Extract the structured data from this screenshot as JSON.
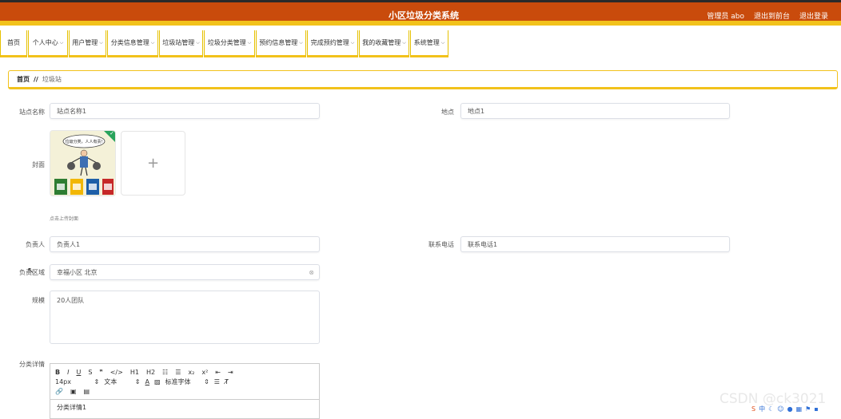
{
  "header": {
    "title": "小区垃圾分类系统",
    "admin_label": "管理员 abo",
    "back_label": "退出到前台",
    "logout_label": "退出登录"
  },
  "nav": {
    "items": [
      {
        "label": "首页",
        "dropdown": false
      },
      {
        "label": "个人中心",
        "dropdown": true
      },
      {
        "label": "用户管理",
        "dropdown": true
      },
      {
        "label": "分类信息管理",
        "dropdown": true
      },
      {
        "label": "垃圾站管理",
        "dropdown": true
      },
      {
        "label": "垃圾分类管理",
        "dropdown": true
      },
      {
        "label": "预约信息管理",
        "dropdown": true
      },
      {
        "label": "完成预约管理",
        "dropdown": true
      },
      {
        "label": "我的收藏管理",
        "dropdown": true
      },
      {
        "label": "系统管理",
        "dropdown": true
      }
    ]
  },
  "breadcrumb": {
    "home": "首页",
    "separator": "//",
    "current": "垃圾站"
  },
  "form": {
    "station_name": {
      "label": "站点名称",
      "value": "站点名称1"
    },
    "location": {
      "label": "地点",
      "value": "地点1"
    },
    "cover": {
      "label": "封面",
      "hint": "点击上传封面",
      "caption": "垃圾分类，人人有责!"
    },
    "manager": {
      "label": "负责人",
      "value": "负责人1"
    },
    "phone": {
      "label": "联系电话",
      "value": "联系电话1"
    },
    "area": {
      "label": "负责区域",
      "value": "幸福小区 北京"
    },
    "scale": {
      "label": "规模",
      "value": "20人团队"
    },
    "detail": {
      "label": "分类详情"
    }
  },
  "editor": {
    "row1": [
      "B",
      "I",
      "U",
      "S",
      "❞",
      "</>",
      "H1",
      "H2",
      "☷",
      "☰",
      "x₂",
      "x²",
      "⇤",
      "⇥"
    ],
    "font_size": "14px",
    "text_label": "文本",
    "font_label": "标准字体",
    "content": "分类详情1"
  },
  "watermark": "CSDN @ck3021"
}
